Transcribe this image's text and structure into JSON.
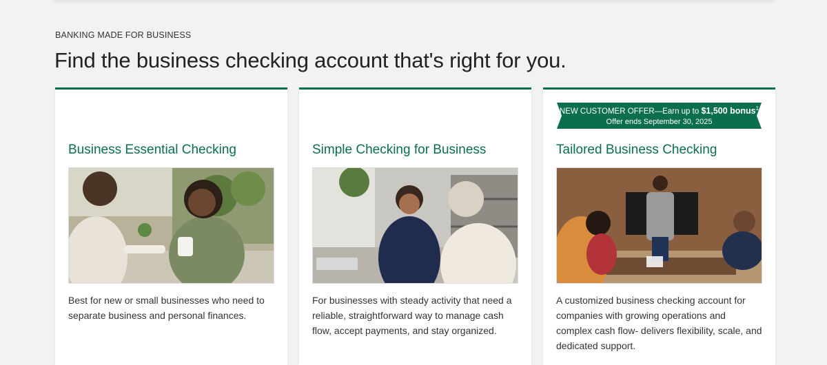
{
  "header": {
    "eyebrow": "BANKING MADE FOR BUSINESS",
    "headline": "Find the business checking account that's right for you."
  },
  "cards": [
    {
      "title": "Business Essential Checking",
      "image_desc": "photo-two-women-meeting-coffee",
      "description": "Best for new or small businesses who need to separate business and personal finances."
    },
    {
      "title": "Simple Checking for Business",
      "image_desc": "photo-two-women-office-conversation",
      "description": "For businesses with steady activity that need a reliable, straightforward way to manage cash flow, accept payments, and stay organized."
    },
    {
      "title": "Tailored Business Checking",
      "image_desc": "photo-man-presenting-conference-room",
      "description": "A customized business checking account for companies with growing operations and complex cash flow- delivers flexibility, scale, and dedicated support.",
      "offer": {
        "prefix": "NEW CUSTOMER OFFER—Earn up to ",
        "amount": "$1,500 bonus",
        "footnote": "1",
        "ends": "Offer ends September 30, 2025"
      }
    }
  ],
  "colors": {
    "accent": "#0a6e4f",
    "background": "#f2f2f2"
  }
}
